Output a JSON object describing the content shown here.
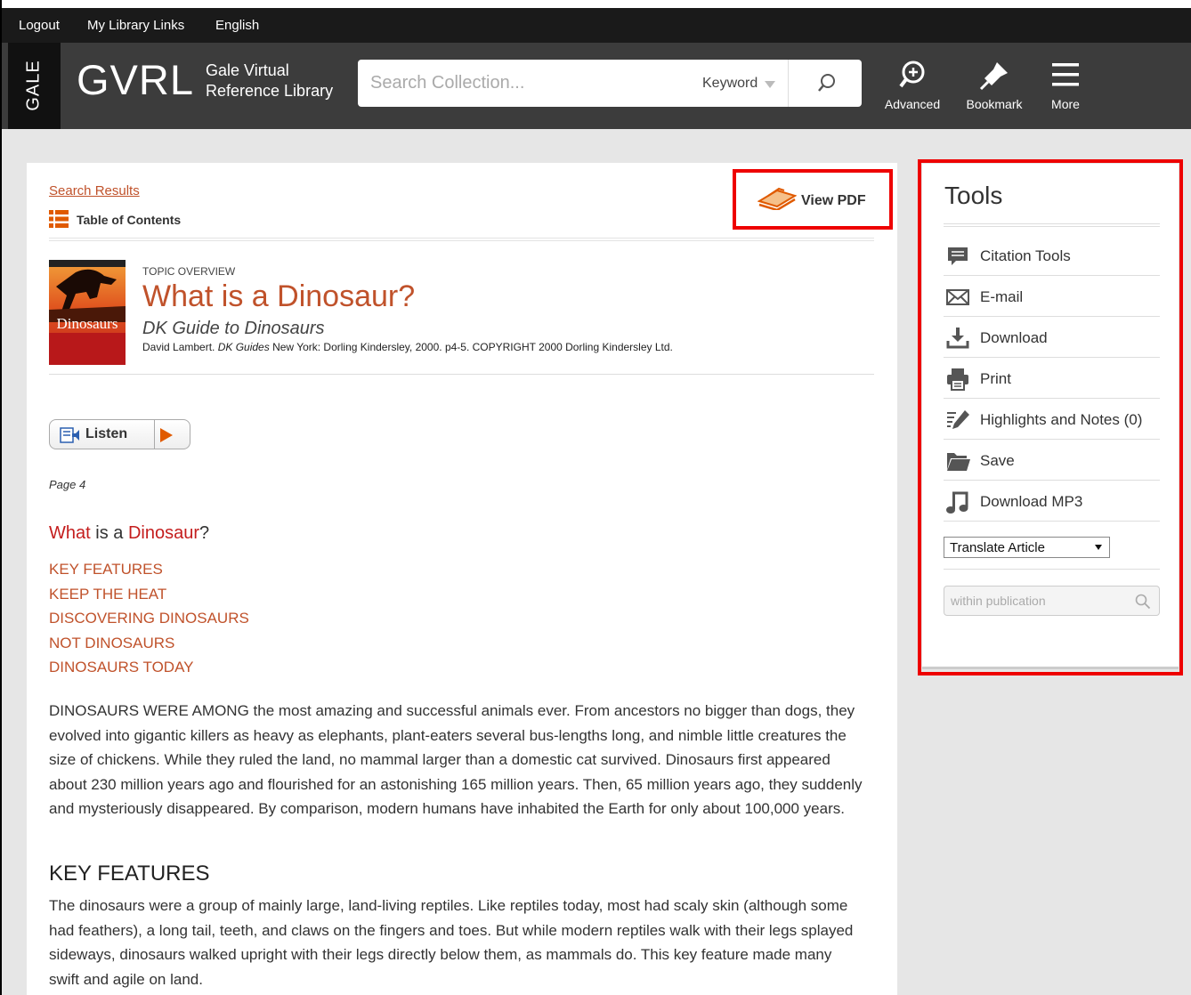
{
  "utility_bar": {
    "logout": "Logout",
    "my_library_links": "My Library Links",
    "language": "English"
  },
  "header": {
    "gale_tab": "GALE",
    "logo": "GVRL",
    "logo_sub_line1": "Gale Virtual",
    "logo_sub_line2": "Reference Library",
    "search_placeholder": "Search Collection...",
    "search_type": "Keyword",
    "advanced": "Advanced",
    "bookmark": "Bookmark",
    "more": "More"
  },
  "article": {
    "search_results": "Search Results",
    "table_of_contents": "Table of Contents",
    "view_pdf": "View PDF",
    "cover_title": "Dinosaurs",
    "topic_label": "TOPIC OVERVIEW",
    "title": "What is a Dinosaur?",
    "book_title": "DK Guide to Dinosaurs",
    "citation_pre": "David Lambert. ",
    "citation_series": "DK Guides",
    "citation_post": " New York: Dorling Kindersley, 2000. p4-5. COPYRIGHT 2000 Dorling Kindersley Ltd.",
    "listen": "Listen",
    "page_number": "Page 4",
    "section_heading_what": "What",
    "section_heading_is_a": " is a ",
    "section_heading_dinosaur": "Dinosaur",
    "section_heading_q": "?",
    "toc_links": [
      "KEY FEATURES",
      "KEEP THE HEAT",
      "DISCOVERING DINOSAURS",
      "NOT DINOSAURS",
      "DINOSAURS TODAY"
    ],
    "paragraph1": "DINOSAURS WERE AMONG the most amazing and successful animals ever. From ancestors no bigger than dogs, they evolved into gigantic killers as heavy as elephants, plant-eaters several bus-lengths long, and nimble little creatures the size of chickens. While they ruled the land, no mammal larger than a domestic cat survived. Dinosaurs first appeared about 230 million years ago and flourished for an astonishing 165 million years. Then, 65 million years ago, they suddenly and mysteriously disappeared. By comparison, modern humans have inhabited the Earth for only about 100,000 years.",
    "heading2": "KEY FEATURES",
    "paragraph2": "The dinosaurs were a group of mainly large, land-living reptiles. Like reptiles today, most had scaly skin (although some had feathers), a long tail, teeth, and claws on the fingers and toes. But while modern reptiles walk with their legs splayed sideways, dinosaurs walked upright with their legs directly below them, as mammals do. This key feature made many swift and agile on land."
  },
  "tools": {
    "title": "Tools",
    "items": [
      {
        "label": "Citation Tools",
        "icon": "citation-icon"
      },
      {
        "label": "E-mail",
        "icon": "email-icon"
      },
      {
        "label": "Download",
        "icon": "download-icon"
      },
      {
        "label": "Print",
        "icon": "print-icon"
      },
      {
        "label": "Highlights and Notes (0)",
        "icon": "highlight-icon"
      },
      {
        "label": "Save",
        "icon": "folder-icon"
      },
      {
        "label": "Download MP3",
        "icon": "music-note-icon"
      }
    ],
    "translate": "Translate Article",
    "within_placeholder": "within publication"
  },
  "colors": {
    "accent": "#c0522b",
    "highlight_box": "#e00000",
    "header_bg": "#3c3c3c"
  }
}
